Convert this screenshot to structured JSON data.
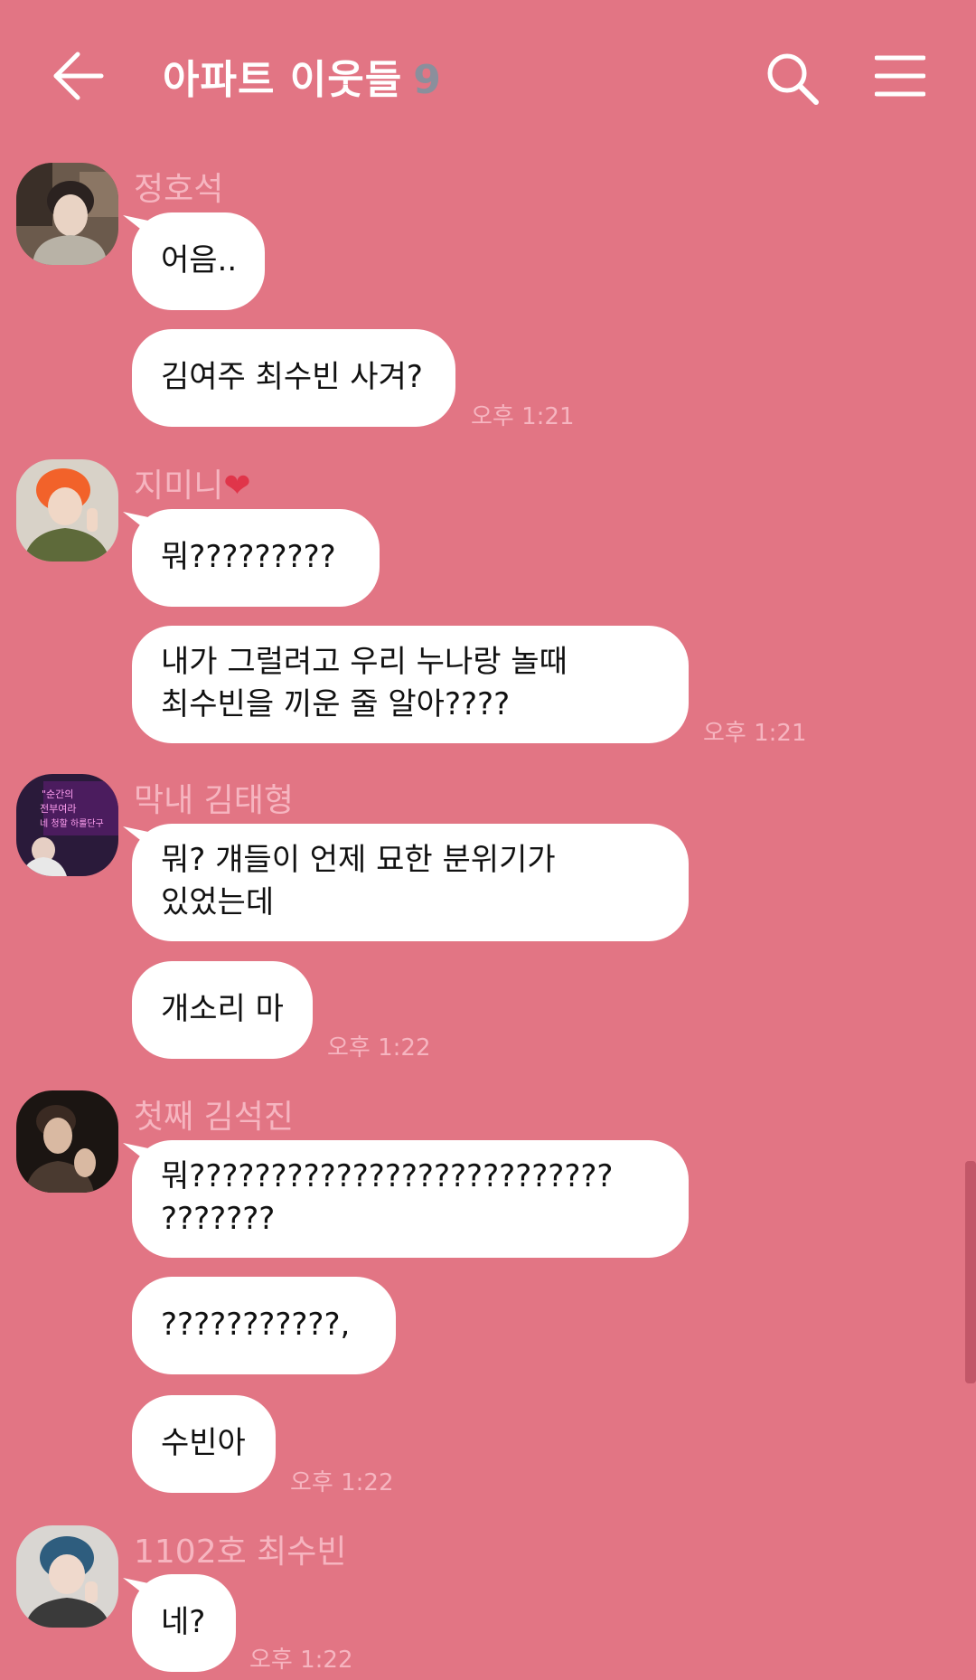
{
  "header": {
    "title": "아파트 이웃들",
    "member_count": "9"
  },
  "messages": [
    {
      "sender": "정호석",
      "bubbles": [
        "어음..",
        "김여주 최수빈 사겨?"
      ],
      "time": "오후 1:21"
    },
    {
      "sender": "지미니",
      "sender_suffix": "❤",
      "bubbles": [
        "뭐?????????",
        "내가 그럴려고 우리 누나랑 놀때",
        "최수빈을 끼운 줄 알아????"
      ],
      "time": "오후 1:21"
    },
    {
      "sender": "막내 김태형",
      "bubbles": [
        "뭐? 걔들이 언제 묘한 분위기가",
        "있었는데",
        "개소리 마"
      ],
      "time": "오후 1:22"
    },
    {
      "sender": "첫째 김석진",
      "bubbles": [
        "뭐??????????????????????????",
        "???????",
        "???????????,",
        "수빈아"
      ],
      "time": "오후 1:22"
    },
    {
      "sender": "1102호 최수빈",
      "bubbles": [
        "네?"
      ],
      "time": "오후 1:22"
    }
  ],
  "avatar_text": {
    "taehyung": [
      "\"순간의",
      "전부여라",
      "네 청할 하룰단구"
    ]
  },
  "colors": {
    "background": "#E27584",
    "bubble": "#FFFFFF",
    "name": "#F6B5C0",
    "count": "#8A8F9C"
  }
}
